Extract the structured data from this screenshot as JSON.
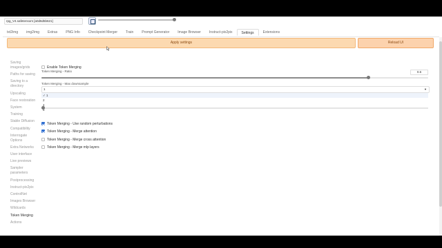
{
  "model": {
    "checkpoint_value": "rpg_V4.safetensors [a0d6d5b621]",
    "refresh_icon": "refresh-icon"
  },
  "tabs": [
    {
      "label": "txt2img"
    },
    {
      "label": "img2img"
    },
    {
      "label": "Extras"
    },
    {
      "label": "PNG Info"
    },
    {
      "label": "Checkpoint Merger"
    },
    {
      "label": "Train"
    },
    {
      "label": "Prompt Generator"
    },
    {
      "label": "Image Browser"
    },
    {
      "label": "Instruct-pix2pix"
    },
    {
      "label": "Settings",
      "active": true
    },
    {
      "label": "Extensions"
    }
  ],
  "actions": {
    "apply_label": "Apply settings",
    "reload_label": "Reload UI"
  },
  "sidebar": {
    "items": [
      {
        "label": "Saving images/grids"
      },
      {
        "label": "Paths for saving"
      },
      {
        "label": "Saving to a directory"
      },
      {
        "label": "Upscaling"
      },
      {
        "label": "Face restoration"
      },
      {
        "label": "System"
      },
      {
        "label": "Training"
      },
      {
        "label": "Stable Diffusion"
      },
      {
        "label": "Compatibility"
      },
      {
        "label": "Interrogate Options"
      },
      {
        "label": "Extra Networks"
      },
      {
        "label": "User interface"
      },
      {
        "label": "Live previews"
      },
      {
        "label": "Sampler parameters"
      },
      {
        "label": "Postprocessing"
      },
      {
        "label": "Instruct-pix2pix"
      },
      {
        "label": "ControlNet"
      },
      {
        "label": "Images Browser"
      },
      {
        "label": "Wildcards"
      },
      {
        "label": "Token Merging",
        "active": true
      },
      {
        "label": "Actions"
      }
    ]
  },
  "token_merging": {
    "enable_label": "Enable Token Merging",
    "enable_checked": false,
    "ratio_label": "Token Merging - Ratio",
    "ratio_value": "0.6",
    "ratio_fraction": 0.845,
    "max_downsample_label": "Token Merging - Max downsample",
    "max_downsample_value": "1",
    "max_downsample_options": [
      {
        "label": "1",
        "selected": true
      },
      {
        "label": "2"
      },
      {
        "label": "4"
      },
      {
        "label": "8"
      }
    ],
    "random_perturbations_label": "Token Merging - Use random perturbations",
    "random_perturbations_checked": true,
    "merge_attention_label": "Token Merging - Merge attention",
    "merge_attention_checked": true,
    "merge_cross_attention_label": "Token Merging - Merge cross attention",
    "merge_cross_attention_checked": false,
    "merge_mlp_label": "Token Merging - Merge mlp layers",
    "merge_mlp_checked": false
  },
  "colors": {
    "primary_button": "#fcd9b0",
    "accent_checkbox": "#2f6fd1"
  }
}
